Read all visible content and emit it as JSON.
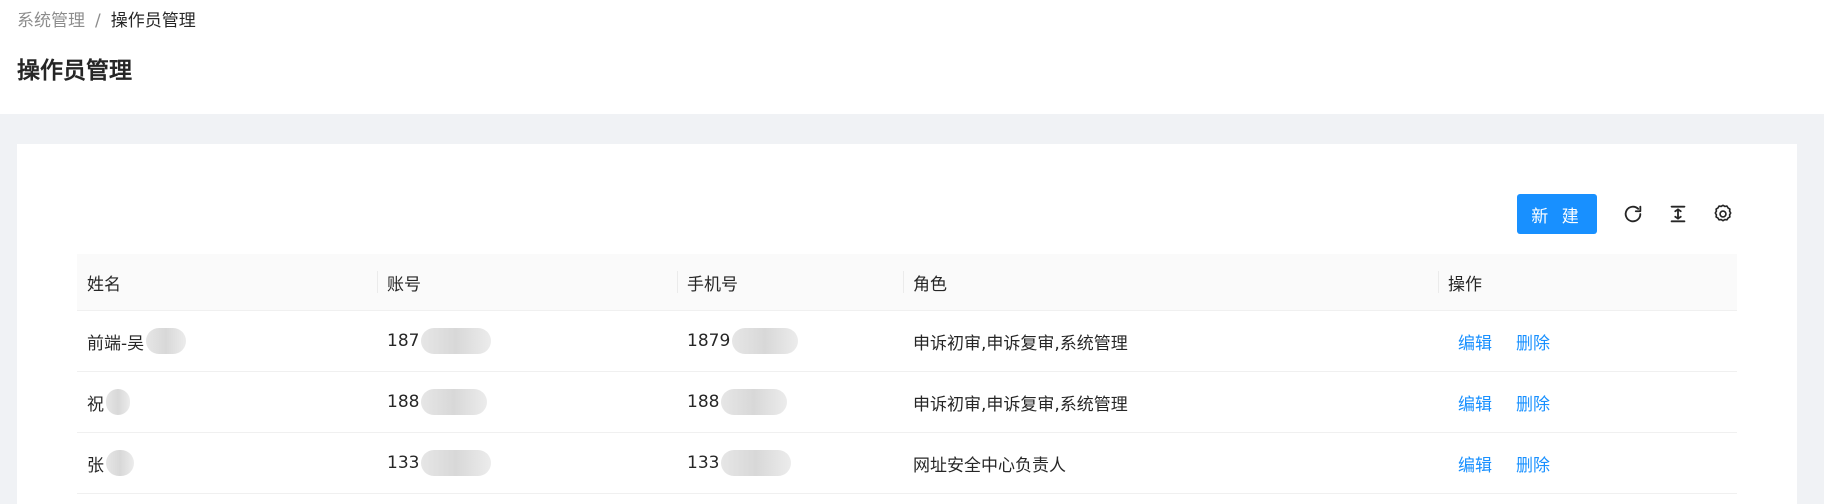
{
  "breadcrumb": {
    "parent": "系统管理",
    "separator": "/",
    "current": "操作员管理"
  },
  "page_title": "操作员管理",
  "toolbar": {
    "new_label": "新 建",
    "icons": [
      "reload-icon",
      "density-icon",
      "settings-icon"
    ]
  },
  "table": {
    "columns": [
      "姓名",
      "账号",
      "手机号",
      "角色",
      "操作"
    ],
    "rows": [
      {
        "name": "前端-吴",
        "account": "187",
        "phone": "1879",
        "role": "申诉初审,申诉复审,系统管理",
        "edit": "编辑",
        "delete": "删除"
      },
      {
        "name": "祝",
        "account": "188",
        "phone": "188",
        "role": "申诉初审,申诉复审,系统管理",
        "edit": "编辑",
        "delete": "删除"
      },
      {
        "name": "张",
        "account": "133",
        "phone": "133",
        "role": "网址安全中心负责人",
        "edit": "编辑",
        "delete": "删除"
      }
    ]
  },
  "colors": {
    "primary": "#1890ff",
    "page_bg": "#f0f2f5"
  }
}
